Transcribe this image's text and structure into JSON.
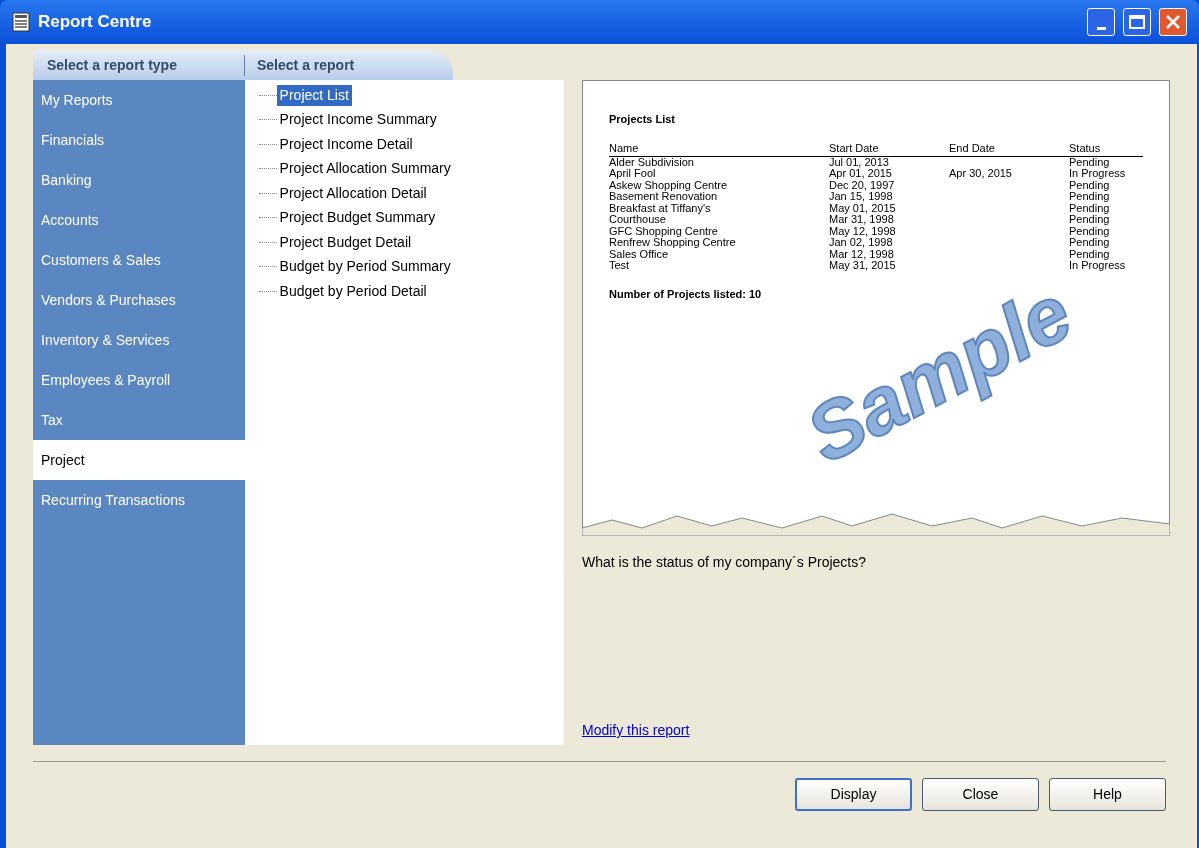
{
  "window": {
    "title": "Report Centre"
  },
  "tabs": [
    {
      "label": "Select a report type"
    },
    {
      "label": "Select a report"
    }
  ],
  "report_types": [
    {
      "label": "My Reports",
      "selected": false
    },
    {
      "label": "Financials",
      "selected": false
    },
    {
      "label": "Banking",
      "selected": false
    },
    {
      "label": "Accounts",
      "selected": false
    },
    {
      "label": "Customers & Sales",
      "selected": false
    },
    {
      "label": "Vendors & Purchases",
      "selected": false
    },
    {
      "label": "Inventory & Services",
      "selected": false
    },
    {
      "label": "Employees & Payroll",
      "selected": false
    },
    {
      "label": "Tax",
      "selected": false
    },
    {
      "label": "Project",
      "selected": true
    },
    {
      "label": "Recurring Transactions",
      "selected": false
    }
  ],
  "reports": [
    {
      "label": "Project List",
      "selected": true
    },
    {
      "label": "Project Income Summary",
      "selected": false
    },
    {
      "label": "Project Income Detail",
      "selected": false
    },
    {
      "label": "Project Allocation Summary",
      "selected": false
    },
    {
      "label": "Project Allocation Detail",
      "selected": false
    },
    {
      "label": "Project Budget Summary",
      "selected": false
    },
    {
      "label": "Project Budget Detail",
      "selected": false
    },
    {
      "label": "Budget by Period Summary",
      "selected": false
    },
    {
      "label": "Budget by Period Detail",
      "selected": false
    }
  ],
  "preview": {
    "title": "Projects List",
    "columns": [
      "Name",
      "Start Date",
      "End Date",
      "Status"
    ],
    "rows": [
      [
        "Alder Subdivision",
        "Jul 01, 2013",
        "",
        "Pending"
      ],
      [
        "April Fool",
        "Apr 01, 2015",
        "Apr 30, 2015",
        "In Progress"
      ],
      [
        "Askew Shopping Centre",
        "Dec 20, 1997",
        "",
        "Pending"
      ],
      [
        "Basement Renovation",
        "Jan 15, 1998",
        "",
        "Pending"
      ],
      [
        "Breakfast at Tiffany's",
        "May 01, 2015",
        "",
        "Pending"
      ],
      [
        "Courthouse",
        "Mar 31, 1998",
        "",
        "Pending"
      ],
      [
        "GFC Shopping Centre",
        "May 12, 1998",
        "",
        "Pending"
      ],
      [
        "Renfrew Shopping Centre",
        "Jan 02, 1998",
        "",
        "Pending"
      ],
      [
        "Sales Office",
        "Mar 12, 1998",
        "",
        "Pending"
      ],
      [
        "Test",
        "May 31, 2015",
        "",
        "In Progress"
      ]
    ],
    "footer": "Number of Projects listed: 10",
    "stamp": "Sample"
  },
  "description": "What is the status of my company´s Projects?",
  "link": "Modify this report",
  "buttons": [
    "Display",
    "Close",
    "Help"
  ]
}
